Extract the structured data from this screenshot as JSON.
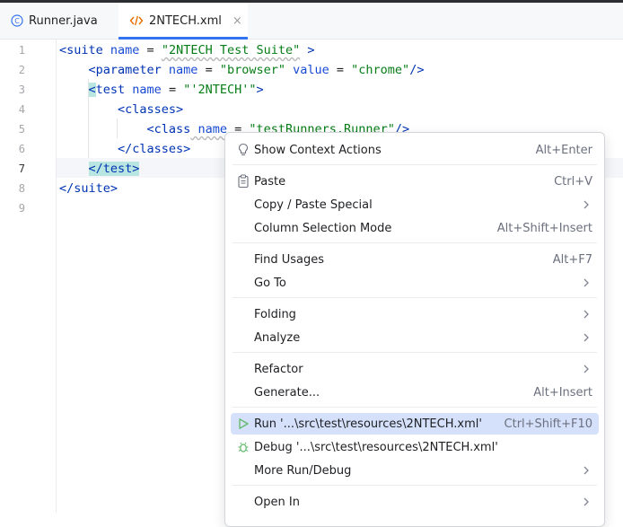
{
  "tabs": [
    {
      "label": "Runner.java",
      "icon": "class-icon",
      "active": false
    },
    {
      "label": "2NTECH.xml",
      "icon": "xml-icon",
      "active": true
    }
  ],
  "close_glyph": "×",
  "editor": {
    "line_numbers": [
      "1",
      "2",
      "3",
      "4",
      "5",
      "6",
      "7",
      "8",
      "9"
    ],
    "current_line": "7",
    "lines": {
      "l1": {
        "open": "<suite",
        "a1": " name",
        "eq1": " = ",
        "v1": "\"2NTECH Test Suite\"",
        "close": " >"
      },
      "l2": {
        "indent": "    ",
        "open": "<parameter",
        "a1": " name",
        "eq1": " = ",
        "v1": "\"browser\"",
        "a2": " value",
        "eq2": " = ",
        "v2": "\"chrome\"",
        "close": "/>"
      },
      "l3": {
        "indent": "    ",
        "lt": "<",
        "tagname": "test",
        "a1": " name",
        "eq1": " = ",
        "v1": "\"'2NTECH'\"",
        "close": ">"
      },
      "l4": {
        "indent": "        ",
        "text": "<classes>"
      },
      "l5": {
        "indent": "            ",
        "open": "<class",
        "a1": " name",
        "eq1": " = ",
        "v1": "\"testRunners.Runner\"",
        "close": "/>"
      },
      "l6": {
        "indent": "        ",
        "text": "</classes>"
      },
      "l7": {
        "indent": "    ",
        "text": "</test>"
      },
      "l8": {
        "text": "</suite>"
      }
    }
  },
  "context_menu": {
    "items": [
      {
        "label": "Show Context Actions",
        "shortcut": "Alt+Enter",
        "icon": "lightbulb-icon"
      },
      {
        "label": "Paste",
        "shortcut": "Ctrl+V",
        "icon": "clipboard-icon"
      },
      {
        "label": "Copy / Paste Special",
        "submenu": true
      },
      {
        "label": "Column Selection Mode",
        "shortcut": "Alt+Shift+Insert"
      },
      {
        "label": "Find Usages",
        "shortcut": "Alt+F7"
      },
      {
        "label": "Go To",
        "submenu": true
      },
      {
        "label": "Folding",
        "submenu": true
      },
      {
        "label": "Analyze",
        "submenu": true
      },
      {
        "label": "Refactor",
        "submenu": true
      },
      {
        "label": "Generate...",
        "shortcut": "Alt+Insert"
      },
      {
        "label": "Run '...\\src\\test\\resources\\2NTECH.xml'",
        "shortcut": "Ctrl+Shift+F10",
        "icon": "run-icon",
        "selected": true
      },
      {
        "label": "Debug '...\\src\\test\\resources\\2NTECH.xml'",
        "icon": "debug-icon"
      },
      {
        "label": "More Run/Debug",
        "submenu": true
      },
      {
        "label": "Open In",
        "submenu": true
      }
    ]
  },
  "colors": {
    "accent": "#3574f0",
    "selection": "#d5e1fb",
    "tag": "#0033b3",
    "attribute": "#174ad4",
    "string": "#067d17",
    "run_green": "#5fb865",
    "debug_green": "#5fb865",
    "xml_orange": "#e76f00"
  }
}
